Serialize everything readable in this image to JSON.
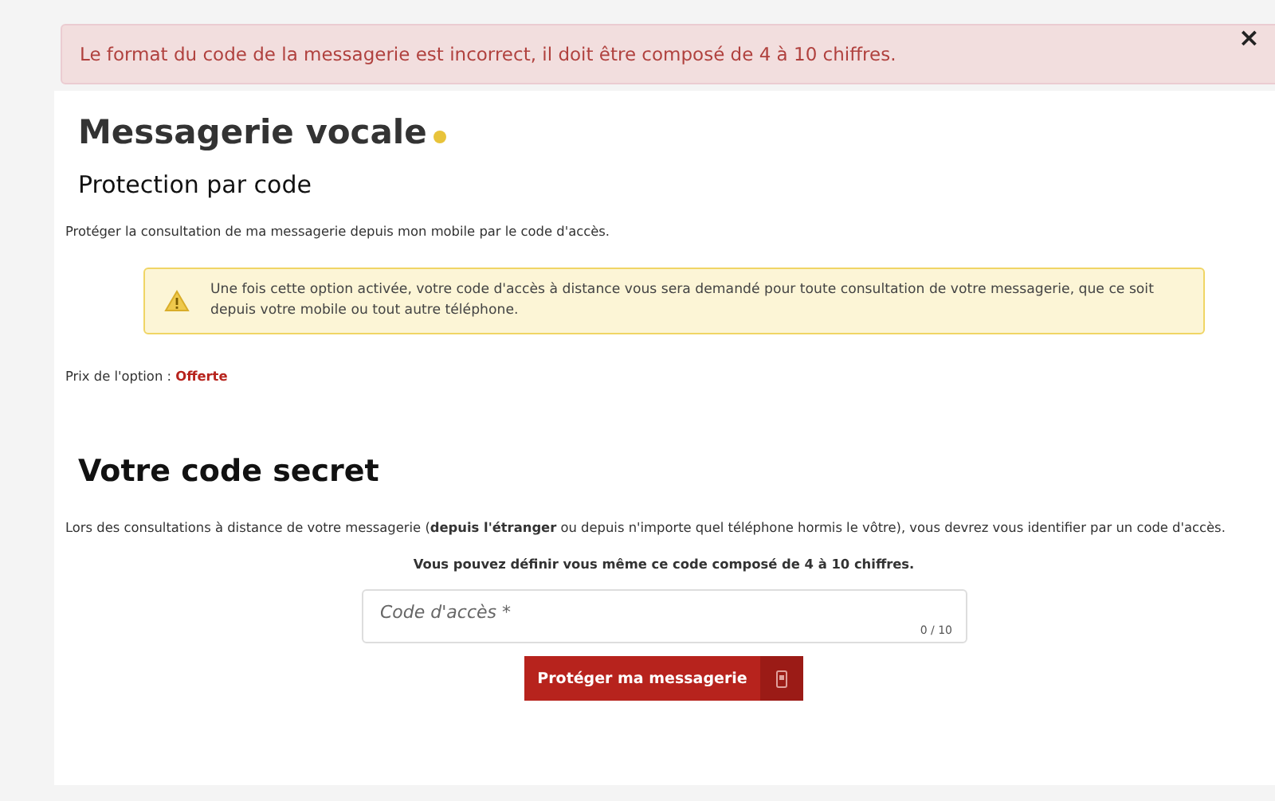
{
  "alert": {
    "message": "Le format du code de la messagerie est incorrect, il doit être composé de 4 à 10 chiffres.",
    "close": "×"
  },
  "title": "Messagerie vocale",
  "subtitle": "Protection par code",
  "intro": "Protéger la consultation de ma messagerie depuis mon mobile par le code d'accès.",
  "warning": "Une fois cette option activée, votre code d'accès à distance vous sera demandé pour toute consultation de votre messagerie, que ce soit depuis votre mobile ou tout autre téléphone.",
  "price": {
    "label": "Prix de l'option :",
    "value": "Offerte"
  },
  "secret_title": "Votre code secret",
  "secret_text": "Lors des consultations à distance de votre messagerie (**depuis l'étranger** ou depuis n'importe quel téléphone hormis le vôtre), vous devrez vous identifier par un code d'accès.",
  "hint": "Vous pouvez définir vous même ce code composé de 4 à 10 chiffres.",
  "code_field": {
    "placeholder": "Code d'accès *",
    "counter": "0 / 10"
  },
  "submit": "Protéger ma messagerie"
}
